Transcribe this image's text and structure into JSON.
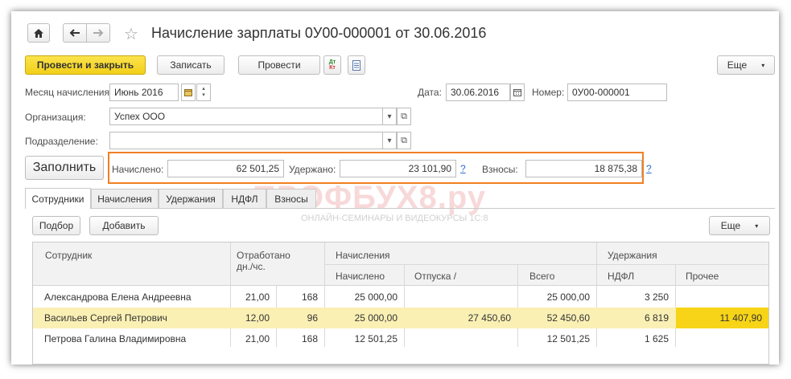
{
  "toolbar": {
    "home_icon": "home-icon",
    "title": "Начисление зарплаты 0У00-000001 от 30.06.2016",
    "post_close_label": "Провести и закрыть",
    "save_label": "Записать",
    "post_label": "Провести",
    "dt_kt_label": "Дт Кт",
    "more_label": "Еще"
  },
  "form": {
    "month_label": "Месяц начисления:",
    "month_value": "Июнь 2016",
    "date_label": "Дата:",
    "date_value": "30.06.2016",
    "number_label": "Номер:",
    "number_value": "0У00-000001",
    "org_label": "Организация:",
    "org_value": "Успех ООО",
    "dept_label": "Подразделение:",
    "dept_value": ""
  },
  "totals": {
    "fill_label": "Заполнить",
    "accrued_label": "Начислено:",
    "accrued_value": "62 501,25",
    "withheld_label": "Удержано:",
    "withheld_value": "23 101,90",
    "contrib_label": "Взносы:",
    "contrib_value": "18 875,38",
    "help": "?"
  },
  "watermark": {
    "main": "ПРОФБУХ8.ру",
    "sub": "ОНЛАЙН-СЕМИНАРЫ И ВИДЕОКУРСЫ 1С:8"
  },
  "tabs": [
    {
      "label": "Сотрудники"
    },
    {
      "label": "Начисления"
    },
    {
      "label": "Удержания"
    },
    {
      "label": "НДФЛ"
    },
    {
      "label": "Взносы"
    }
  ],
  "subtoolbar": {
    "pick_label": "Подбор",
    "add_label": "Добавить",
    "more_label": "Еще"
  },
  "table": {
    "headers": {
      "employee": "Сотрудник",
      "worked": "Отработано",
      "worked_sub": "дн./чс.",
      "accruals": "Начисления",
      "accrued": "Начислено",
      "vacation": "Отпуска /",
      "total": "Всего",
      "withholdings": "Удержания",
      "ndfl": "НДФЛ",
      "other": "Прочее"
    },
    "rows": [
      {
        "name": "Александрова Елена Андреевна",
        "days": "21,00",
        "hours": "168",
        "accrued": "25 000,00",
        "vacation": "",
        "total": "25 000,00",
        "ndfl": "3 250",
        "other": ""
      },
      {
        "name": "Васильев Сергей Петрович",
        "days": "12,00",
        "hours": "96",
        "accrued": "25 000,00",
        "vacation": "27 450,60",
        "total": "52 450,60",
        "ndfl": "6 819",
        "other": "11 407,90"
      },
      {
        "name": "Петрова Галина Владимировна",
        "days": "21,00",
        "hours": "168",
        "accrued": "12 501,25",
        "vacation": "",
        "total": "12 501,25",
        "ndfl": "1 625",
        "other": ""
      }
    ]
  }
}
